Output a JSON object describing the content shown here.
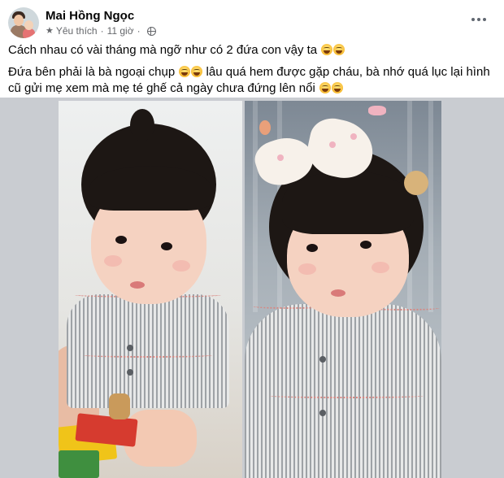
{
  "post": {
    "author_name": "Mai Hồng Ngọc",
    "badge_label": "Yêu thích",
    "separator": "·",
    "time": "11 giờ",
    "privacy_icon": "globe-icon",
    "more_icon": "more-options-icon"
  },
  "content": {
    "line1": "Cách nhau có vài tháng mà ngỡ như có 2 đứa con vậy ta",
    "line2_part1": "Đứa bên phải là bà ngoại chụp",
    "line2_part2": "lâu quá hem được gặp cháu, bà nhớ quá lục lại hình cũ gửi mẹ xem mà mẹ té ghế cả ngày chưa đứng lên nổi",
    "emoji_name": "grinning-squinting-emoji"
  },
  "photos": [
    {
      "name": "baby-photo-left"
    },
    {
      "name": "baby-photo-right"
    }
  ],
  "colors": {
    "name": "#050505",
    "secondary": "#65676b",
    "photo_background": "#c9ccd1"
  }
}
